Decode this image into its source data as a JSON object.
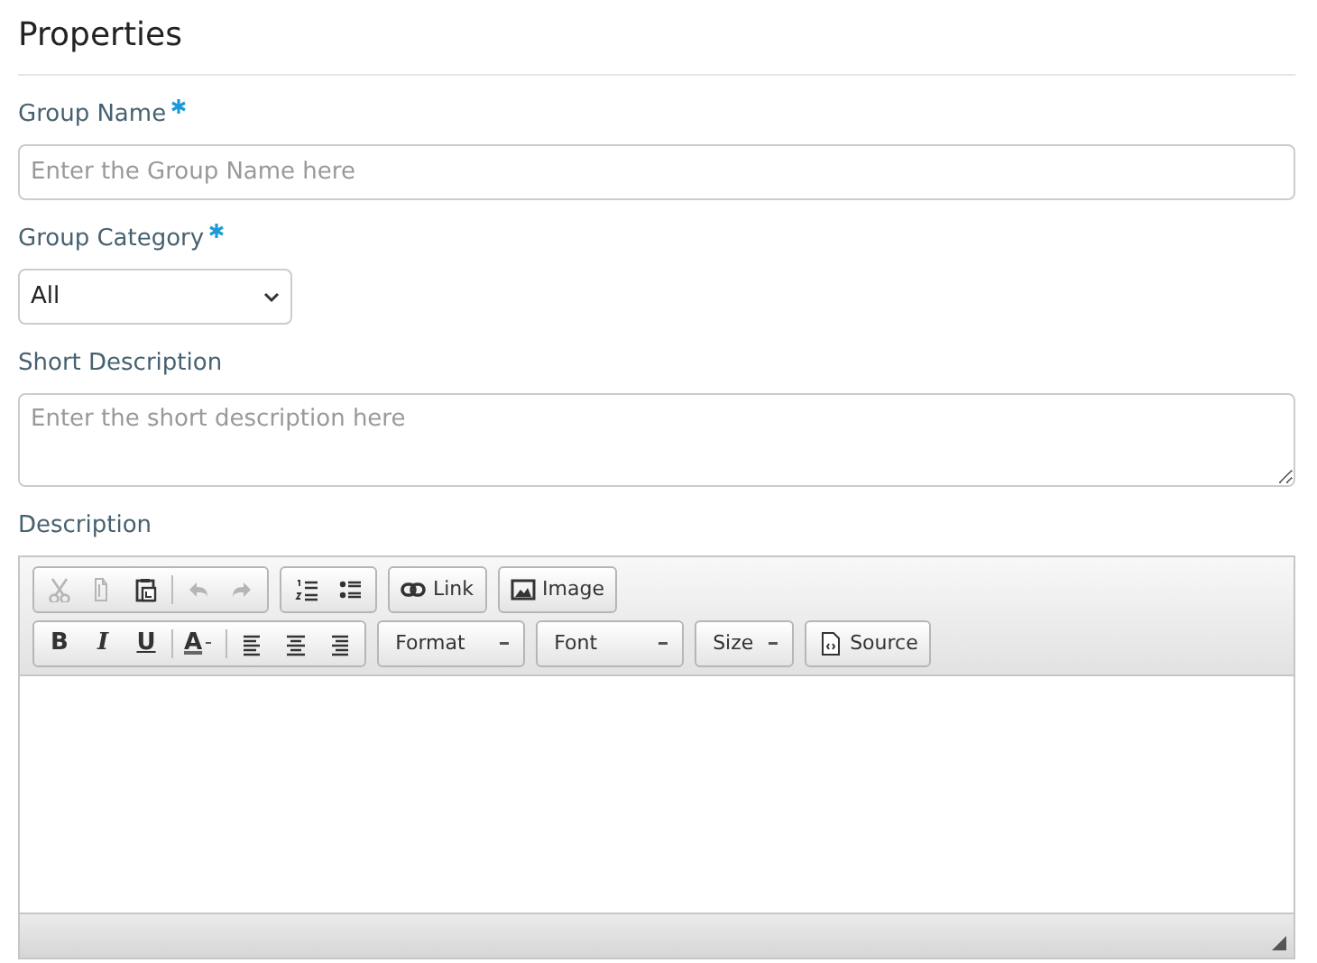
{
  "title": "Properties",
  "group_name": {
    "label": "Group Name",
    "required": true,
    "placeholder": "Enter the Group Name here"
  },
  "group_category": {
    "label": "Group Category",
    "required": true,
    "value": "All"
  },
  "short_description": {
    "label": "Short Description",
    "placeholder": "Enter the short description here"
  },
  "description": {
    "label": "Description",
    "toolbar_rows": [
      [
        [
          {
            "kind": "cut",
            "disabled": true
          },
          {
            "kind": "copy",
            "disabled": true
          },
          {
            "kind": "paste",
            "disabled": false
          },
          {
            "kind": "separator"
          },
          {
            "kind": "undo",
            "disabled": true
          },
          {
            "kind": "redo",
            "disabled": true
          }
        ],
        [
          {
            "kind": "numbered-list",
            "disabled": false
          },
          {
            "kind": "bulleted-list",
            "disabled": false
          }
        ],
        [
          {
            "kind": "link",
            "label": "Link",
            "disabled": false
          }
        ],
        [
          {
            "kind": "image",
            "label": "Image",
            "disabled": false
          }
        ]
      ],
      [
        [
          {
            "kind": "bold",
            "label": "B",
            "disabled": false
          },
          {
            "kind": "italic",
            "label": "I",
            "disabled": false
          },
          {
            "kind": "underline",
            "label": "U",
            "disabled": false
          },
          {
            "kind": "separator"
          },
          {
            "kind": "text-color",
            "label": "A",
            "disabled": false
          },
          {
            "kind": "separator"
          },
          {
            "kind": "align-left",
            "disabled": false
          },
          {
            "kind": "align-center",
            "disabled": false
          },
          {
            "kind": "align-right",
            "disabled": false
          }
        ],
        [
          {
            "kind": "combo",
            "label": "Format",
            "disabled": false
          }
        ],
        [
          {
            "kind": "combo",
            "label": "Font",
            "disabled": false
          }
        ],
        [
          {
            "kind": "combo",
            "label": "Size",
            "disabled": false
          }
        ],
        [
          {
            "kind": "source",
            "label": "Source",
            "disabled": false
          }
        ]
      ]
    ]
  }
}
